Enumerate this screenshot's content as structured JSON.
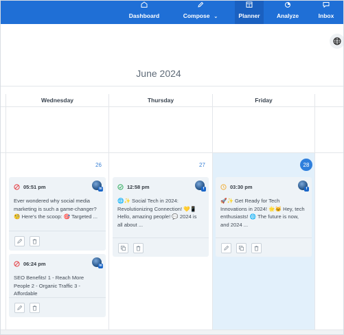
{
  "nav": {
    "items": [
      {
        "label": "Dashboard",
        "icon": "home-icon"
      },
      {
        "label": "Compose",
        "icon": "pencil-icon",
        "dropdown": true
      },
      {
        "label": "Planner",
        "icon": "calendar-grid-icon",
        "active": true
      },
      {
        "label": "Analyze",
        "icon": "pie-chart-icon"
      },
      {
        "label": "Inbox",
        "icon": "chat-bubble-icon"
      }
    ]
  },
  "calendar": {
    "month_title": "June 2024",
    "columns": [
      "Wednesday",
      "Thursday",
      "Friday"
    ],
    "days": {
      "wed": "26",
      "thu": "27",
      "fri": "28"
    }
  },
  "posts": {
    "wed_1": {
      "time": "05:51 pm",
      "status": "failed",
      "text": "Ever wondered why social media marketing is such a game-changer? 🧐 Here's the scoop: 🎯 Targeted ..."
    },
    "wed_2": {
      "time": "06:24 pm",
      "status": "failed",
      "text": "SEO Benefits! 1 - Reach More People 2 - Organic Traffic 3 - Affordable"
    },
    "thu_1": {
      "time": "12:58 pm",
      "status": "published",
      "text": "🌐✨ Social Tech in 2024: Revolutionizing Connection! 💛📱 Hello, amazing people! 💬 2024 is all about ..."
    },
    "fri_1": {
      "time": "03:30 pm",
      "status": "scheduled",
      "text": "🚀✨ Get Ready for Tech Innovations in 2024! 🌟🐱 Hey, tech enthusiasts! 🌐 The future is now, and 2024 ..."
    }
  },
  "colors": {
    "nav_bg": "#1f6fd6",
    "today_bg": "#e2f0fb",
    "accent": "#2f7fdc",
    "failed": "#e5484d",
    "published": "#3fb36b",
    "scheduled": "#f0b54a"
  }
}
